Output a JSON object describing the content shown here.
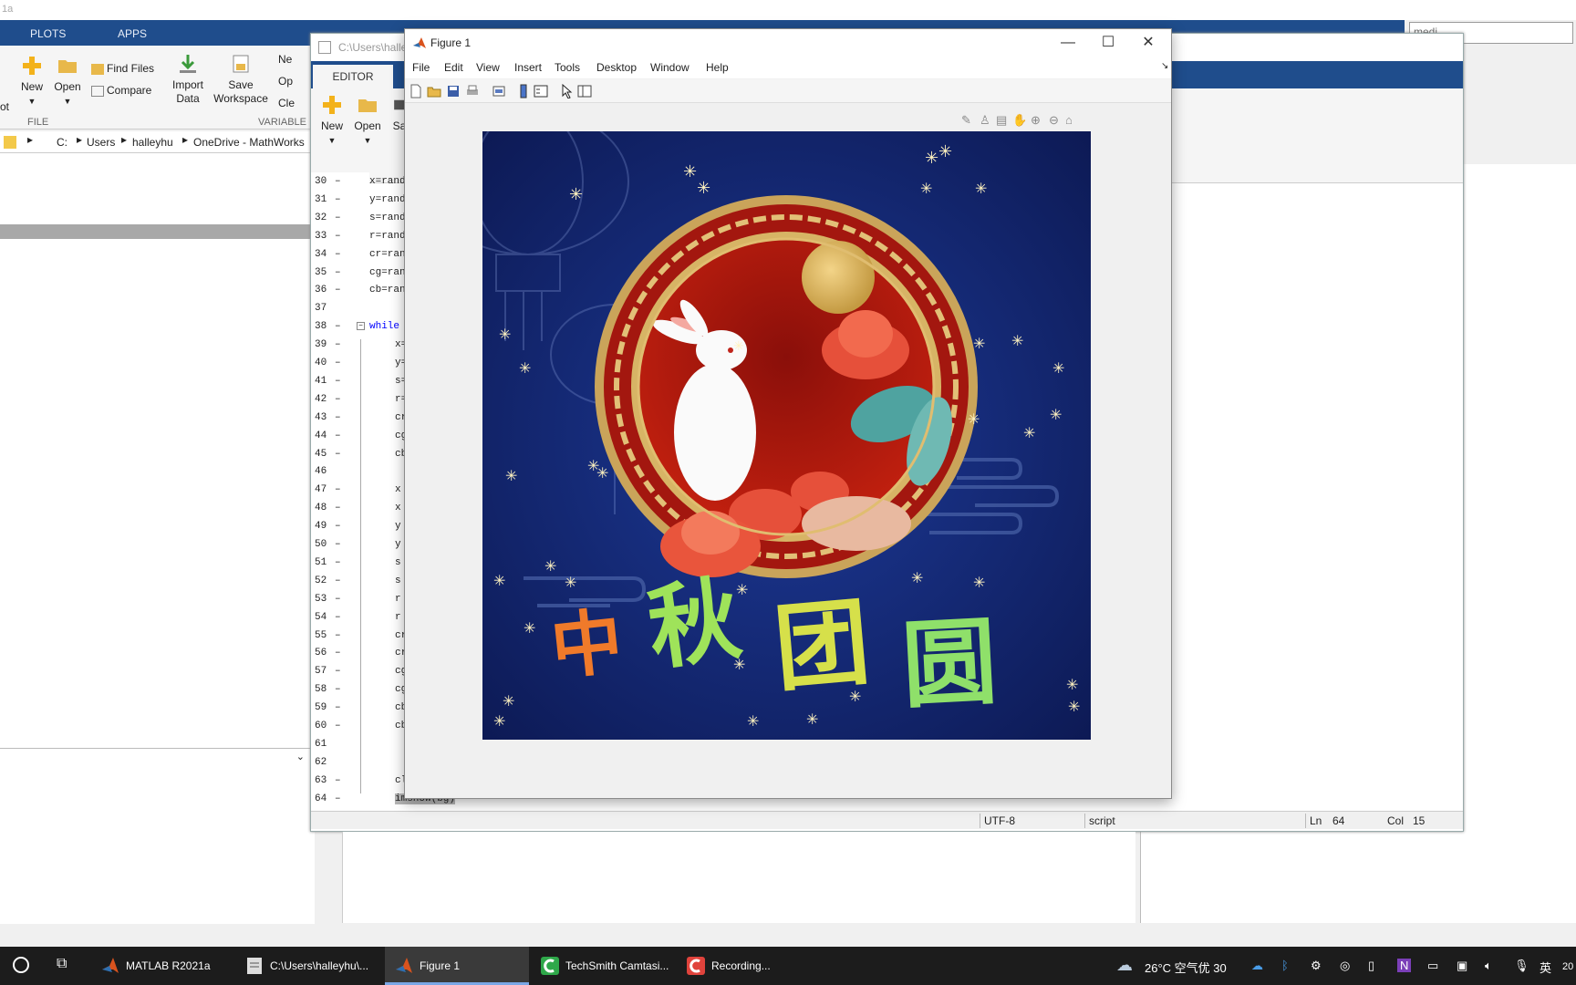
{
  "top_strip": {
    "title": "1a"
  },
  "matlab_tabs": [
    "PLOTS",
    "APPS"
  ],
  "matlab_ribbon": {
    "buttons": {
      "new": "New",
      "open": "Open",
      "find_files": "Find Files",
      "compare": "Compare",
      "import_data_1": "Import",
      "import_data_2": "Data",
      "save_ws_1": "Save",
      "save_ws_2": "Workspace",
      "new_var": "Ne",
      "open_var": "Op",
      "clear": "Cle",
      "left_cut": "ot"
    },
    "groups": {
      "file": "FILE",
      "variable": "VARIABLE"
    }
  },
  "address_bar": {
    "parts": [
      "C:",
      "Users",
      "halleyhu",
      "OneDrive - MathWorks"
    ]
  },
  "editor": {
    "title": "C:\\Users\\halle",
    "tab": "EDITOR",
    "ribbon": {
      "new": "New",
      "open": "Open",
      "save": "Sa"
    },
    "lines": [
      {
        "n": "30",
        "dash": true,
        "code": "x=rand",
        "indent": 0
      },
      {
        "n": "31",
        "dash": true,
        "code": "y=rand",
        "indent": 0
      },
      {
        "n": "32",
        "dash": true,
        "code": "s=rand",
        "indent": 0
      },
      {
        "n": "33",
        "dash": true,
        "code": "r=rand",
        "indent": 0
      },
      {
        "n": "34",
        "dash": true,
        "code": "cr=ran",
        "indent": 0
      },
      {
        "n": "35",
        "dash": true,
        "code": "cg=ran",
        "indent": 0
      },
      {
        "n": "36",
        "dash": true,
        "code": "cb=ran",
        "indent": 0
      },
      {
        "n": "37",
        "dash": false,
        "code": "",
        "indent": 0
      },
      {
        "n": "38",
        "dash": true,
        "code": "while",
        "indent": 0,
        "kw": true
      },
      {
        "n": "39",
        "dash": true,
        "code": "x=",
        "indent": 1
      },
      {
        "n": "40",
        "dash": true,
        "code": "y=",
        "indent": 1
      },
      {
        "n": "41",
        "dash": true,
        "code": "s=",
        "indent": 1
      },
      {
        "n": "42",
        "dash": true,
        "code": "r=",
        "indent": 1
      },
      {
        "n": "43",
        "dash": true,
        "code": "cr",
        "indent": 1
      },
      {
        "n": "44",
        "dash": true,
        "code": "cg",
        "indent": 1
      },
      {
        "n": "45",
        "dash": true,
        "code": "cb",
        "indent": 1
      },
      {
        "n": "46",
        "dash": false,
        "code": "",
        "indent": 1
      },
      {
        "n": "47",
        "dash": true,
        "code": "x",
        "indent": 1
      },
      {
        "n": "48",
        "dash": true,
        "code": "x",
        "indent": 1
      },
      {
        "n": "49",
        "dash": true,
        "code": "y",
        "indent": 1
      },
      {
        "n": "50",
        "dash": true,
        "code": "y",
        "indent": 1
      },
      {
        "n": "51",
        "dash": true,
        "code": "s",
        "indent": 1
      },
      {
        "n": "52",
        "dash": true,
        "code": "s",
        "indent": 1
      },
      {
        "n": "53",
        "dash": true,
        "code": "r",
        "indent": 1
      },
      {
        "n": "54",
        "dash": true,
        "code": "r",
        "indent": 1
      },
      {
        "n": "55",
        "dash": true,
        "code": "cr",
        "indent": 1
      },
      {
        "n": "56",
        "dash": true,
        "code": "cr",
        "indent": 1
      },
      {
        "n": "57",
        "dash": true,
        "code": "cg",
        "indent": 1
      },
      {
        "n": "58",
        "dash": true,
        "code": "cg",
        "indent": 1
      },
      {
        "n": "59",
        "dash": true,
        "code": "cb",
        "indent": 1
      },
      {
        "n": "60",
        "dash": true,
        "code": "cb",
        "indent": 1
      },
      {
        "n": "61",
        "dash": false,
        "code": "",
        "indent": 1
      },
      {
        "n": "62",
        "dash": false,
        "code": "",
        "indent": 1
      },
      {
        "n": "63",
        "dash": true,
        "code": "cl",
        "indent": 1
      },
      {
        "n": "64",
        "dash": true,
        "code": "imshow(bg)",
        "indent": 1,
        "highlight": true
      }
    ],
    "status": {
      "encoding": "UTF-8",
      "type": "script",
      "ln_label": "Ln",
      "ln": "64",
      "col_label": "Col",
      "col": "15"
    }
  },
  "figure": {
    "title": "Figure 1",
    "menu": [
      "File",
      "Edit",
      "View",
      "Insert",
      "Tools",
      "Desktop",
      "Window",
      "Help"
    ],
    "image_text": [
      "中",
      "秋",
      "团",
      "圆"
    ]
  },
  "search": {
    "value": "medi"
  },
  "taskbar": {
    "items": [
      "MATLAB R2021a",
      "C:\\Users\\halleyhu\\...",
      "Figure 1",
      "TechSmith Camtasi...",
      "Recording..."
    ],
    "active_index": 2,
    "weather": "26°C 空气优 30",
    "lang": "英",
    "clock": "20"
  },
  "colors": {
    "matlab_blue": "#1f4d8c",
    "taskbar": "#1c1c1c",
    "image_bg": "#13246a",
    "frame_red": "#a3170f",
    "gold": "#d8b25a"
  }
}
